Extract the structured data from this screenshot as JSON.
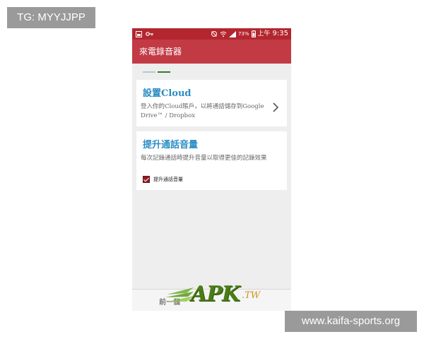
{
  "watermarks": {
    "top_left": "TG: MYYJJPP",
    "bottom_right": "www.kaifa-sports.org"
  },
  "statusbar": {
    "battery_percent": "73%",
    "time_period": "上午",
    "time": "9:35",
    "icons": [
      "screenshot-icon",
      "key-icon",
      "silent-icon",
      "wifi-icon",
      "signal-icon",
      "battery-icon"
    ]
  },
  "appbar": {
    "title": "來電錄音器"
  },
  "cards": {
    "cloud": {
      "title": "設置Cloud",
      "description": "登入你的Cloud賬戶，以將通話儲存到Google Drive™ / Dropbox"
    },
    "volume": {
      "title": "提升通話音量",
      "description": "每次記錄通話時提升音量以取得更佳的記錄效果",
      "checkbox_label": "提升通話音量",
      "checked": true
    }
  },
  "bottombar": {
    "prev_label": "前一個"
  },
  "logo": {
    "text": "APK",
    "suffix": ".TW"
  },
  "colors": {
    "statusbar": "#b3262f",
    "appbar": "#c23b44",
    "accent_title": "#2a8dc5",
    "checkbox": "#8e1b22"
  }
}
